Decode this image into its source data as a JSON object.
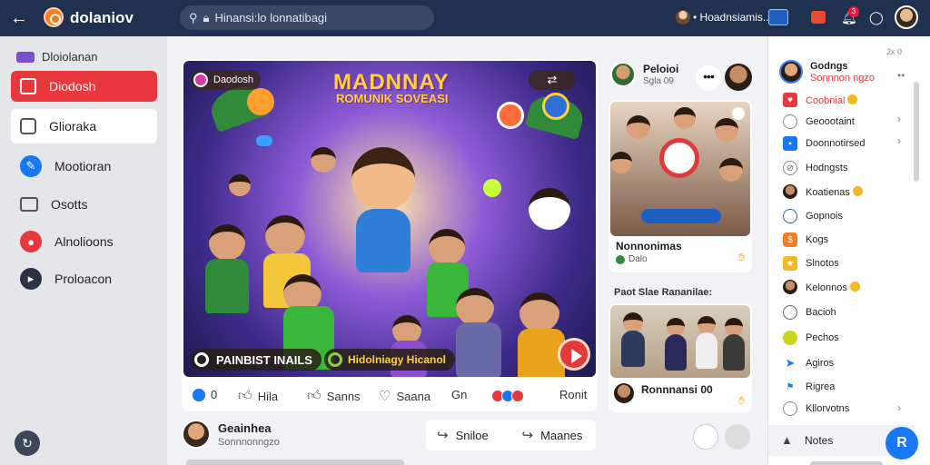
{
  "topbar": {
    "app_name": "dolaniov",
    "search_placeholder": "Hinansi:lo lonnatibagi",
    "user_text": "• Hoadnsiamis..",
    "badge_count": "3"
  },
  "sidebar": {
    "header": "Dloiolanan",
    "items": [
      {
        "label": "Diodosh"
      },
      {
        "label": "Glioraka"
      },
      {
        "label": "Mootioran"
      },
      {
        "label": "Osotts"
      },
      {
        "label": "Alnolioons"
      },
      {
        "label": "Proloacon"
      }
    ]
  },
  "post": {
    "image_title": "MADNNAY",
    "image_subtitle": "ROMUNIK SOVEASI",
    "image_tag": "Daodosh",
    "image_caption": "PAINBIST INAILS",
    "image_caption2": "Hidolniagy Hicanol",
    "actions": {
      "reactions_count": "0",
      "like_label": "Hila",
      "comment_label": "Sanns",
      "share_label": "Saana",
      "extra_label": "Gn",
      "more_label": "Ronit"
    }
  },
  "author": {
    "name": "Geainhea",
    "subtitle": "Sonnnonngzo"
  },
  "post_buttons": {
    "left": "Sniloe",
    "right": "Maanes"
  },
  "middle": {
    "header_name": "Peloioi",
    "header_sub": "Sgla 09",
    "card1_title": "Nonnonimas",
    "card1_sub": "Dalo",
    "section_label": "Paot Slae Rananilae:",
    "card2_title": "Ronnnansi 00"
  },
  "right_panel": {
    "top_label": "2x 0",
    "profile_name": "Godngs",
    "profile_sub": "Sonnnon ngzo",
    "items": [
      {
        "label": "Coobnial",
        "color": "#e8383d"
      },
      {
        "label": "Geoootaint",
        "color": "#888888"
      },
      {
        "label": "Doonnotirsed",
        "color": "#1877f2"
      },
      {
        "label": "Hodngsts",
        "color": "#888888"
      },
      {
        "label": "Koatienas",
        "color": "#5a3a2a"
      },
      {
        "label": "Gopnois",
        "color": "#3b5998"
      },
      {
        "label": "Kogs",
        "color": "#f57c1f"
      },
      {
        "label": "Slnotos",
        "color": "#f5b824"
      },
      {
        "label": "Kelonnos",
        "color": "#7b4a3a"
      },
      {
        "label": "Bacioh",
        "color": "#666666"
      },
      {
        "label": "Pechos",
        "color": "#c7d61a"
      },
      {
        "label": "Agiros",
        "color": "#1877f2"
      },
      {
        "label": "Rigrea",
        "color": "#1877f2"
      },
      {
        "label": "Kllorvotns",
        "color": "#888888"
      }
    ],
    "notes_label": "Notes"
  }
}
